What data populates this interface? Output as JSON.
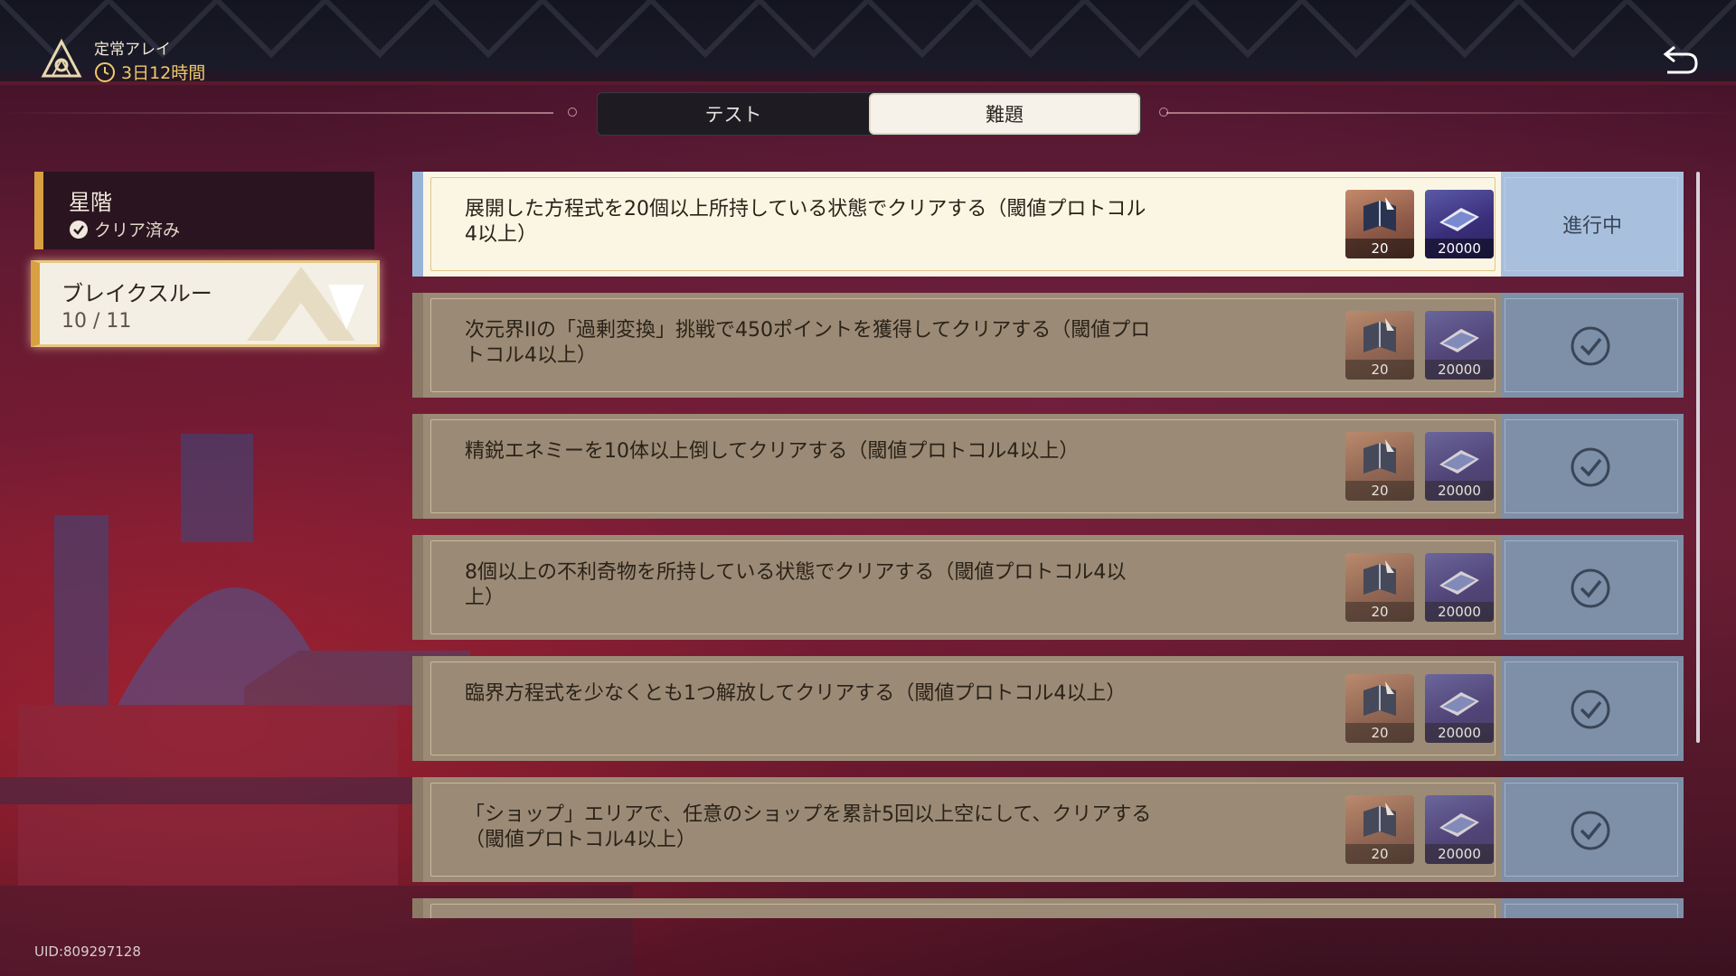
{
  "header": {
    "mode_title": "定常アレイ",
    "timer": "3日12時間"
  },
  "tabs": [
    {
      "label": "テスト",
      "active": false
    },
    {
      "label": "難題",
      "active": true
    }
  ],
  "left_panel": {
    "star_tier": {
      "name": "星階",
      "status": "クリア済み"
    },
    "breakthrough": {
      "name": "ブレイクスルー",
      "progress": "10 / 11"
    }
  },
  "quests": [
    {
      "text": "展開した方程式を20個以上所持している状態でクリアする（閾値プロトコル4以上）",
      "reward1": "20",
      "reward2": "20000",
      "status": "進行中"
    },
    {
      "text": "次元界IIの「過剰変換」挑戦で450ポイントを獲得してクリアする（閾値プロトコル4以上）",
      "reward1": "20",
      "reward2": "20000",
      "status": "done"
    },
    {
      "text": "精鋭エネミーを10体以上倒してクリアする（閾値プロトコル4以上）",
      "reward1": "20",
      "reward2": "20000",
      "status": "done"
    },
    {
      "text": "8個以上の不利奇物を所持している状態でクリアする（閾値プロトコル4以上）",
      "reward1": "20",
      "reward2": "20000",
      "status": "done"
    },
    {
      "text": "臨界方程式を少なくとも1つ解放してクリアする（閾値プロトコル4以上）",
      "reward1": "20",
      "reward2": "20000",
      "status": "done"
    },
    {
      "text": "「ショップ」エリアで、任意のショップを累計5回以上空にして、クリアする（閾値プロトコル4以上）",
      "reward1": "20",
      "reward2": "20000",
      "status": "done"
    }
  ],
  "footer": {
    "uid": "UID:809297128"
  },
  "colors": {
    "accent_gold": "#d8a040",
    "timer": "#f0c86a",
    "active_status": "#a8c0de"
  },
  "icons": {
    "logo": "triangle-emblem-icon",
    "timer": "clock-icon",
    "back": "back-arrow-icon",
    "done": "checkmark-icon",
    "reward1": "book-icon",
    "reward2": "chip-icon"
  }
}
